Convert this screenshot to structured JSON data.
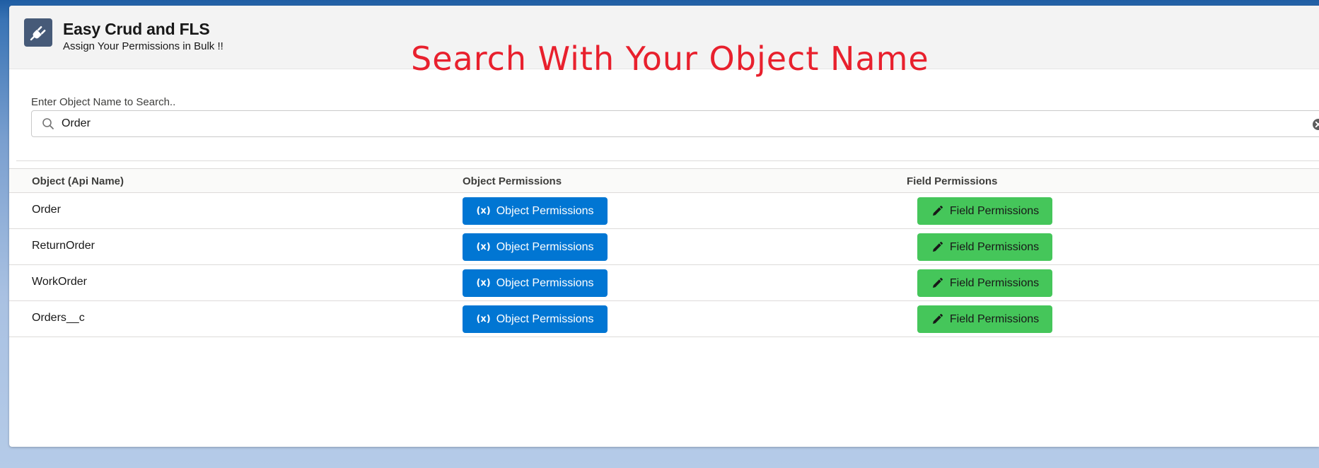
{
  "app": {
    "title": "Easy Crud and FLS",
    "subtitle": "Assign Your Permissions in Bulk !!",
    "icon": "plug-icon"
  },
  "overlay_caption": "Search With Your Object Name",
  "search": {
    "label": "Enter Object Name to Search..",
    "value": "Order",
    "placeholder": ""
  },
  "table": {
    "headers": [
      "Object (Api Name)",
      "Object Permissions",
      "Field Permissions"
    ],
    "rows": [
      {
        "name": "Order",
        "object_button": "Object Permissions",
        "field_button": "Field Permissions"
      },
      {
        "name": "ReturnOrder",
        "object_button": "Object Permissions",
        "field_button": "Field Permissions"
      },
      {
        "name": "WorkOrder",
        "object_button": "Object Permissions",
        "field_button": "Field Permissions"
      },
      {
        "name": "Orders__c",
        "object_button": "Object Permissions",
        "field_button": "Field Permissions"
      }
    ]
  },
  "icons": {
    "object_button_icon": "formula-icon",
    "field_button_icon": "pencil-icon",
    "search_icon": "search-icon",
    "clear_icon": "clear-icon"
  },
  "colors": {
    "object_button": "#0176d3",
    "field_button": "#45c65a",
    "caption": "#e8202d",
    "app_icon_bg": "#465a78"
  }
}
